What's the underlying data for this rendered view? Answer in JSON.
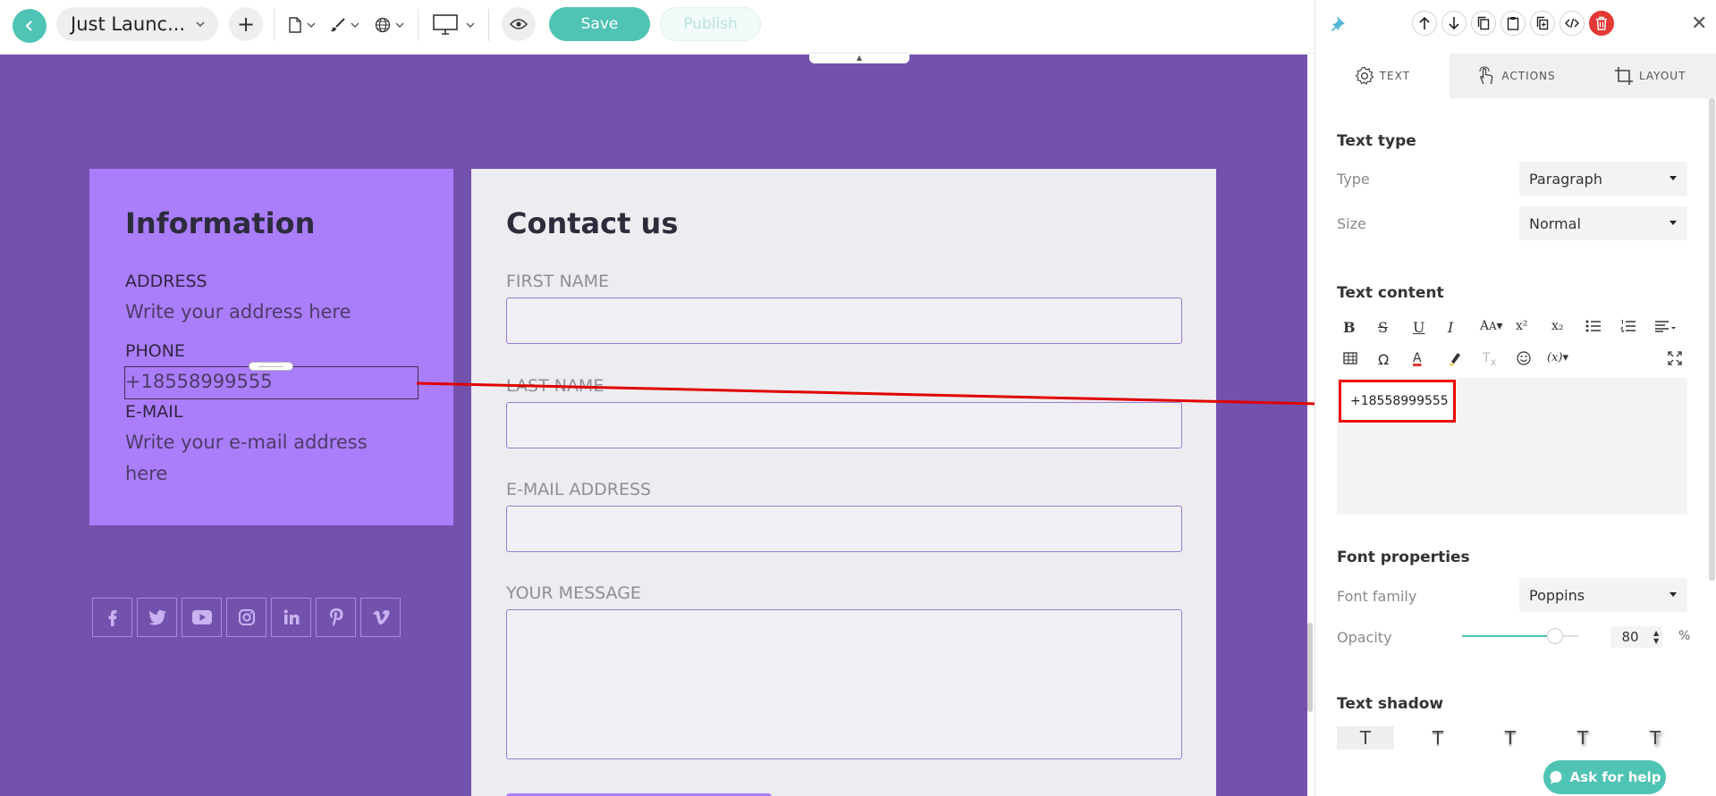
{
  "toolbar": {
    "project_title": "Just Launc...",
    "save_label": "Save",
    "publish_label": "Publish"
  },
  "canvas": {
    "information": {
      "title": "Information",
      "address_label": "ADDRESS",
      "address_value": "Write your address here",
      "phone_label": "PHONE",
      "phone_value": "+18558999555",
      "email_label": "E-MAIL",
      "email_value_line1": "Write your e-mail address",
      "email_value_line2": "here"
    },
    "contact": {
      "title": "Contact us",
      "first_name_label": "FIRST NAME",
      "last_name_label": "LAST NAME",
      "email_label": "E-MAIL ADDRESS",
      "message_label": "YOUR MESSAGE"
    },
    "socials": [
      "facebook-icon",
      "twitter-icon",
      "youtube-icon",
      "instagram-icon",
      "linkedin-icon",
      "pinterest-icon",
      "vimeo-icon"
    ]
  },
  "panel": {
    "tabs": [
      {
        "label": "TEXT",
        "icon": "gear-icon",
        "active": true
      },
      {
        "label": "ACTIONS",
        "icon": "pointer-icon",
        "active": false
      },
      {
        "label": "LAYOUT",
        "icon": "crop-icon",
        "active": false
      }
    ],
    "text_type": {
      "title": "Text type",
      "type_label": "Type",
      "type_value": "Paragraph",
      "size_label": "Size",
      "size_value": "Normal"
    },
    "text_content": {
      "title": "Text content",
      "value": "+18558999555"
    },
    "font_properties": {
      "title": "Font properties",
      "family_label": "Font family",
      "family_value": "Poppins",
      "opacity_label": "Opacity",
      "opacity_value": "80",
      "opacity_unit": "%",
      "opacity_fraction": 0.8
    },
    "text_shadow": {
      "title": "Text shadow"
    },
    "help_label": "Ask for help"
  },
  "colors": {
    "accent": "#4fc3b4",
    "canvas_bg": "#7352ae",
    "info_bg": "#aa7dfb",
    "contact_bg": "#edecf1",
    "annotation": "#e00000",
    "delete": "#e53935"
  }
}
